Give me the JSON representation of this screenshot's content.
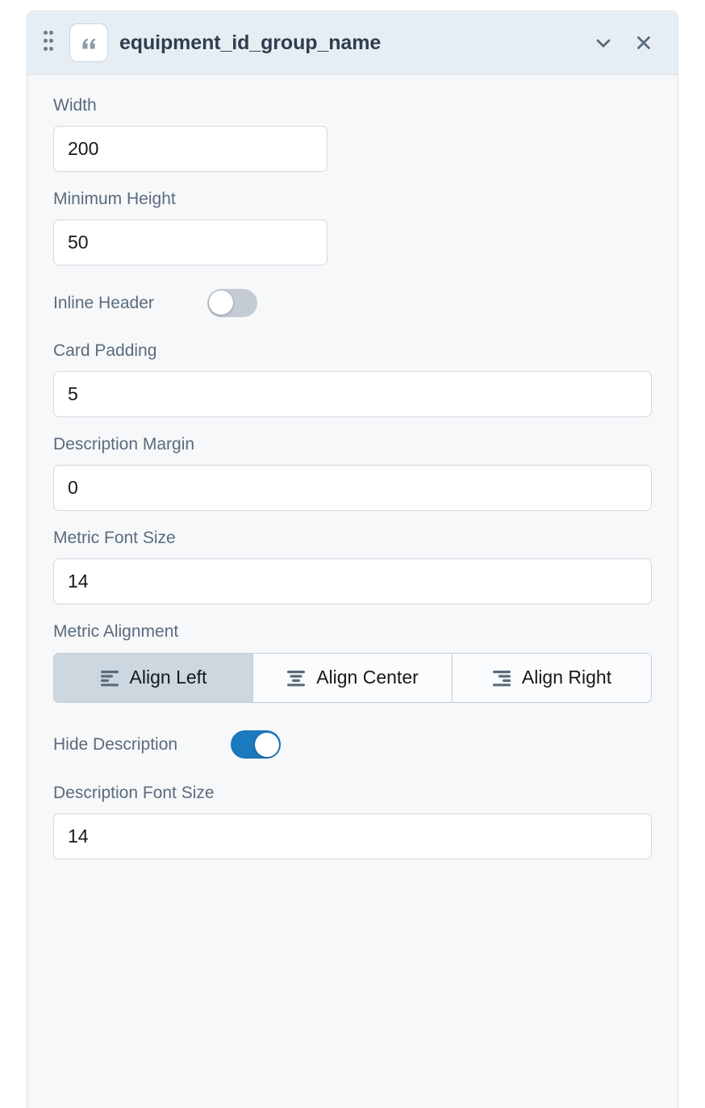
{
  "header": {
    "title": "equipment_id_group_name",
    "drag_handle_icon": "drag-dots-icon",
    "type_icon": "quote-icon",
    "collapse_icon": "chevron-down-icon",
    "close_icon": "close-icon"
  },
  "colors": {
    "panel_body_bg": "#f6f8fa",
    "panel_header_bg": "#e7eef3",
    "label": "#5a6b7c",
    "toggle_on": "#1b79bd",
    "toggle_off": "#c3ccd4",
    "segment_selected_bg": "#ccd7e0",
    "input_border": "#d4d8dd",
    "icon": "#5a6b7c"
  },
  "fields": {
    "width": {
      "label": "Width",
      "value": "200",
      "placeholder": "Width"
    },
    "minimum_height": {
      "label": "Minimum Height",
      "value": "50",
      "placeholder": "Minimum Height"
    },
    "inline_header": {
      "label": "Inline Header",
      "value": "off"
    },
    "card_padding": {
      "label": "Card Padding",
      "value": "5",
      "placeholder": "Card Padding"
    },
    "description_margin": {
      "label": "Description Margin",
      "value": "0",
      "placeholder": "Description Margin"
    },
    "metric_font_size": {
      "label": "Metric Font Size",
      "value": "14",
      "placeholder": "Metric Font Size"
    },
    "metric_alignment": {
      "label": "Metric Alignment",
      "selected": "Align Left",
      "options": [
        {
          "label": "Align Left",
          "icon": "align-left-icon"
        },
        {
          "label": "Align Center",
          "icon": "align-center-icon"
        },
        {
          "label": "Align Right",
          "icon": "align-right-icon"
        }
      ]
    },
    "hide_description": {
      "label": "Hide Description",
      "value": "on"
    },
    "description_font_size": {
      "label": "Description Font Size",
      "value": "14",
      "placeholder": "Description Font Size"
    }
  }
}
